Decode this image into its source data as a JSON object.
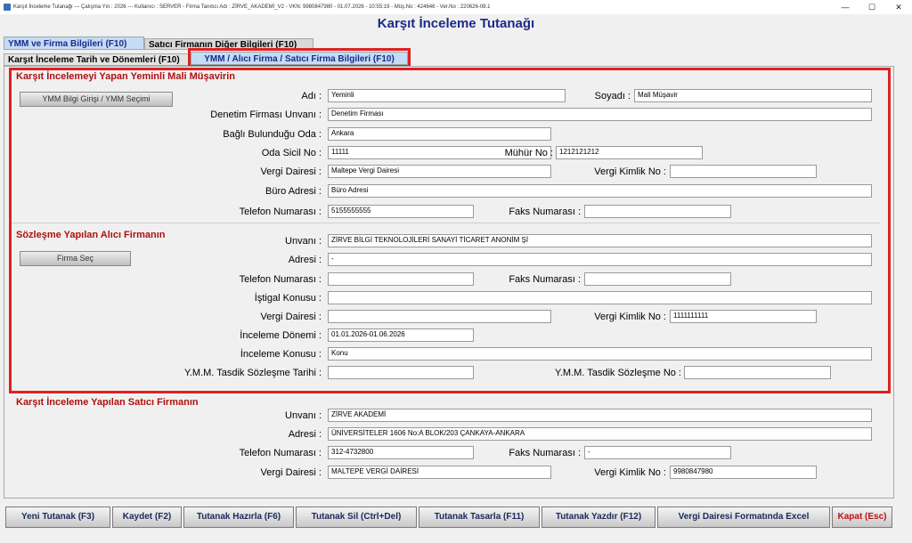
{
  "window": {
    "title": "Karşıt İnceleme Tutanağı  ---  Çalışma Yılı : 2026  ---  Kullanıcı : SERVER - Firma Tanıtıcı Adı : ZİRVE_AKADEMİ_V2 - VKN: 9980847980 - 01.07.2026 - 10:55:19 - Müş.No : 424646 - Ver.No : 220626-08.1",
    "minimize": "—",
    "maximize": "☐",
    "close": "✕"
  },
  "page_title": "Karşıt İnceleme Tutanağı",
  "tabs": {
    "tab1": "YMM ve Firma Bilgileri (F10)",
    "tab2": "Satıcı Firmanın Diğer Bilgileri (F10)",
    "tab3": "Karşıt İnceleme Tarih ve Dönemleri (F10)",
    "tab4": "YMM / Alıcı Firma / Satıcı Firma Bilgileri (F10)"
  },
  "ymm": {
    "section_title": "Karşıt İncelemeyi Yapan Yeminli Mali Müşavirin",
    "button": "YMM Bilgi Girişi / YMM Seçimi",
    "labels": {
      "adi": "Adı :",
      "soyadi": "Soyadı :",
      "denetim": "Denetim Firması Unvanı :",
      "oda": "Bağlı Bulunduğu Oda :",
      "oda_sicil": "Oda Sicil No :",
      "muhur": "Mühür No :",
      "vergi_dairesi": "Vergi Dairesi :",
      "vkn": "Vergi Kimlik No :",
      "buro": "Büro Adresi :",
      "telefon": "Telefon Numarası :",
      "faks": "Faks Numarası :"
    },
    "values": {
      "adi": "Yeminli",
      "soyadi": "Mali Müşavir",
      "denetim": "Denetim Firması",
      "oda": "Ankara",
      "oda_sicil": "11111",
      "muhur": "1212121212",
      "vergi_dairesi": "Maltepe Vergi Dairesi",
      "vkn": "",
      "buro": "Büro Adresi",
      "telefon": "5155555555",
      "faks": ""
    }
  },
  "alici": {
    "section_title": "Sözleşme Yapılan Alıcı Firmanın",
    "button": "Firma Seç",
    "labels": {
      "unvan": "Unvanı :",
      "adres": "Adresi :",
      "telefon": "Telefon Numarası :",
      "faks": "Faks Numarası :",
      "istigal": "İştigal Konusu :",
      "vergi_dairesi": "Vergi Dairesi :",
      "vkn": "Vergi Kimlik No :",
      "donem": "İnceleme Dönemi :",
      "konu": "İnceleme Konusu :",
      "tasdik_tarih": "Y.M.M. Tasdik Sözleşme Tarihi :",
      "tasdik_no": "Y.M.M. Tasdik Sözleşme No :"
    },
    "values": {
      "unvan": "ZİRVE BİLGİ TEKNOLOJİLERİ SANAYİ TİCARET ANONİM Şİ",
      "adres": "-",
      "telefon": "",
      "faks": "",
      "istigal": "",
      "vergi_dairesi": "",
      "vkn": "1111111111",
      "donem": "01.01.2026-01.06.2026",
      "konu": "Konu",
      "tasdik_tarih": "",
      "tasdik_no": ""
    }
  },
  "satici": {
    "section_title": "Karşıt İnceleme Yapılan Satıcı Firmanın",
    "labels": {
      "unvan": "Unvanı :",
      "adres": "Adresi :",
      "telefon": "Telefon Numarası :",
      "faks": "Faks Numarası :",
      "vergi_dairesi": "Vergi Dairesi :",
      "vkn": "Vergi Kimlik No :"
    },
    "values": {
      "unvan": "ZİRVE AKADEMİ",
      "adres": "ÜNİVERSİTELER  1606  No:A BLOK/203  ÇANKAYA-ANKARA",
      "telefon": "312-4732800",
      "faks": "-",
      "vergi_dairesi": "MALTEPE VERGİ DAİRESİ",
      "vkn": "9980847980"
    }
  },
  "footer": {
    "new": "Yeni Tutanak (F3)",
    "save": "Kaydet (F2)",
    "prepare": "Tutanak Hazırla (F6)",
    "delete": "Tutanak Sil (Ctrl+Del)",
    "design": "Tutanak Tasarla (F11)",
    "print": "Tutanak Yazdır (F12)",
    "excel": "Vergi Dairesi Formatında Excel",
    "close": "Kapat (Esc)"
  },
  "colors": {
    "title_blue": "#1a2a8a",
    "section_red": "#b01010",
    "highlight_red": "#e02020",
    "tab_active": "#c4dcf4"
  }
}
